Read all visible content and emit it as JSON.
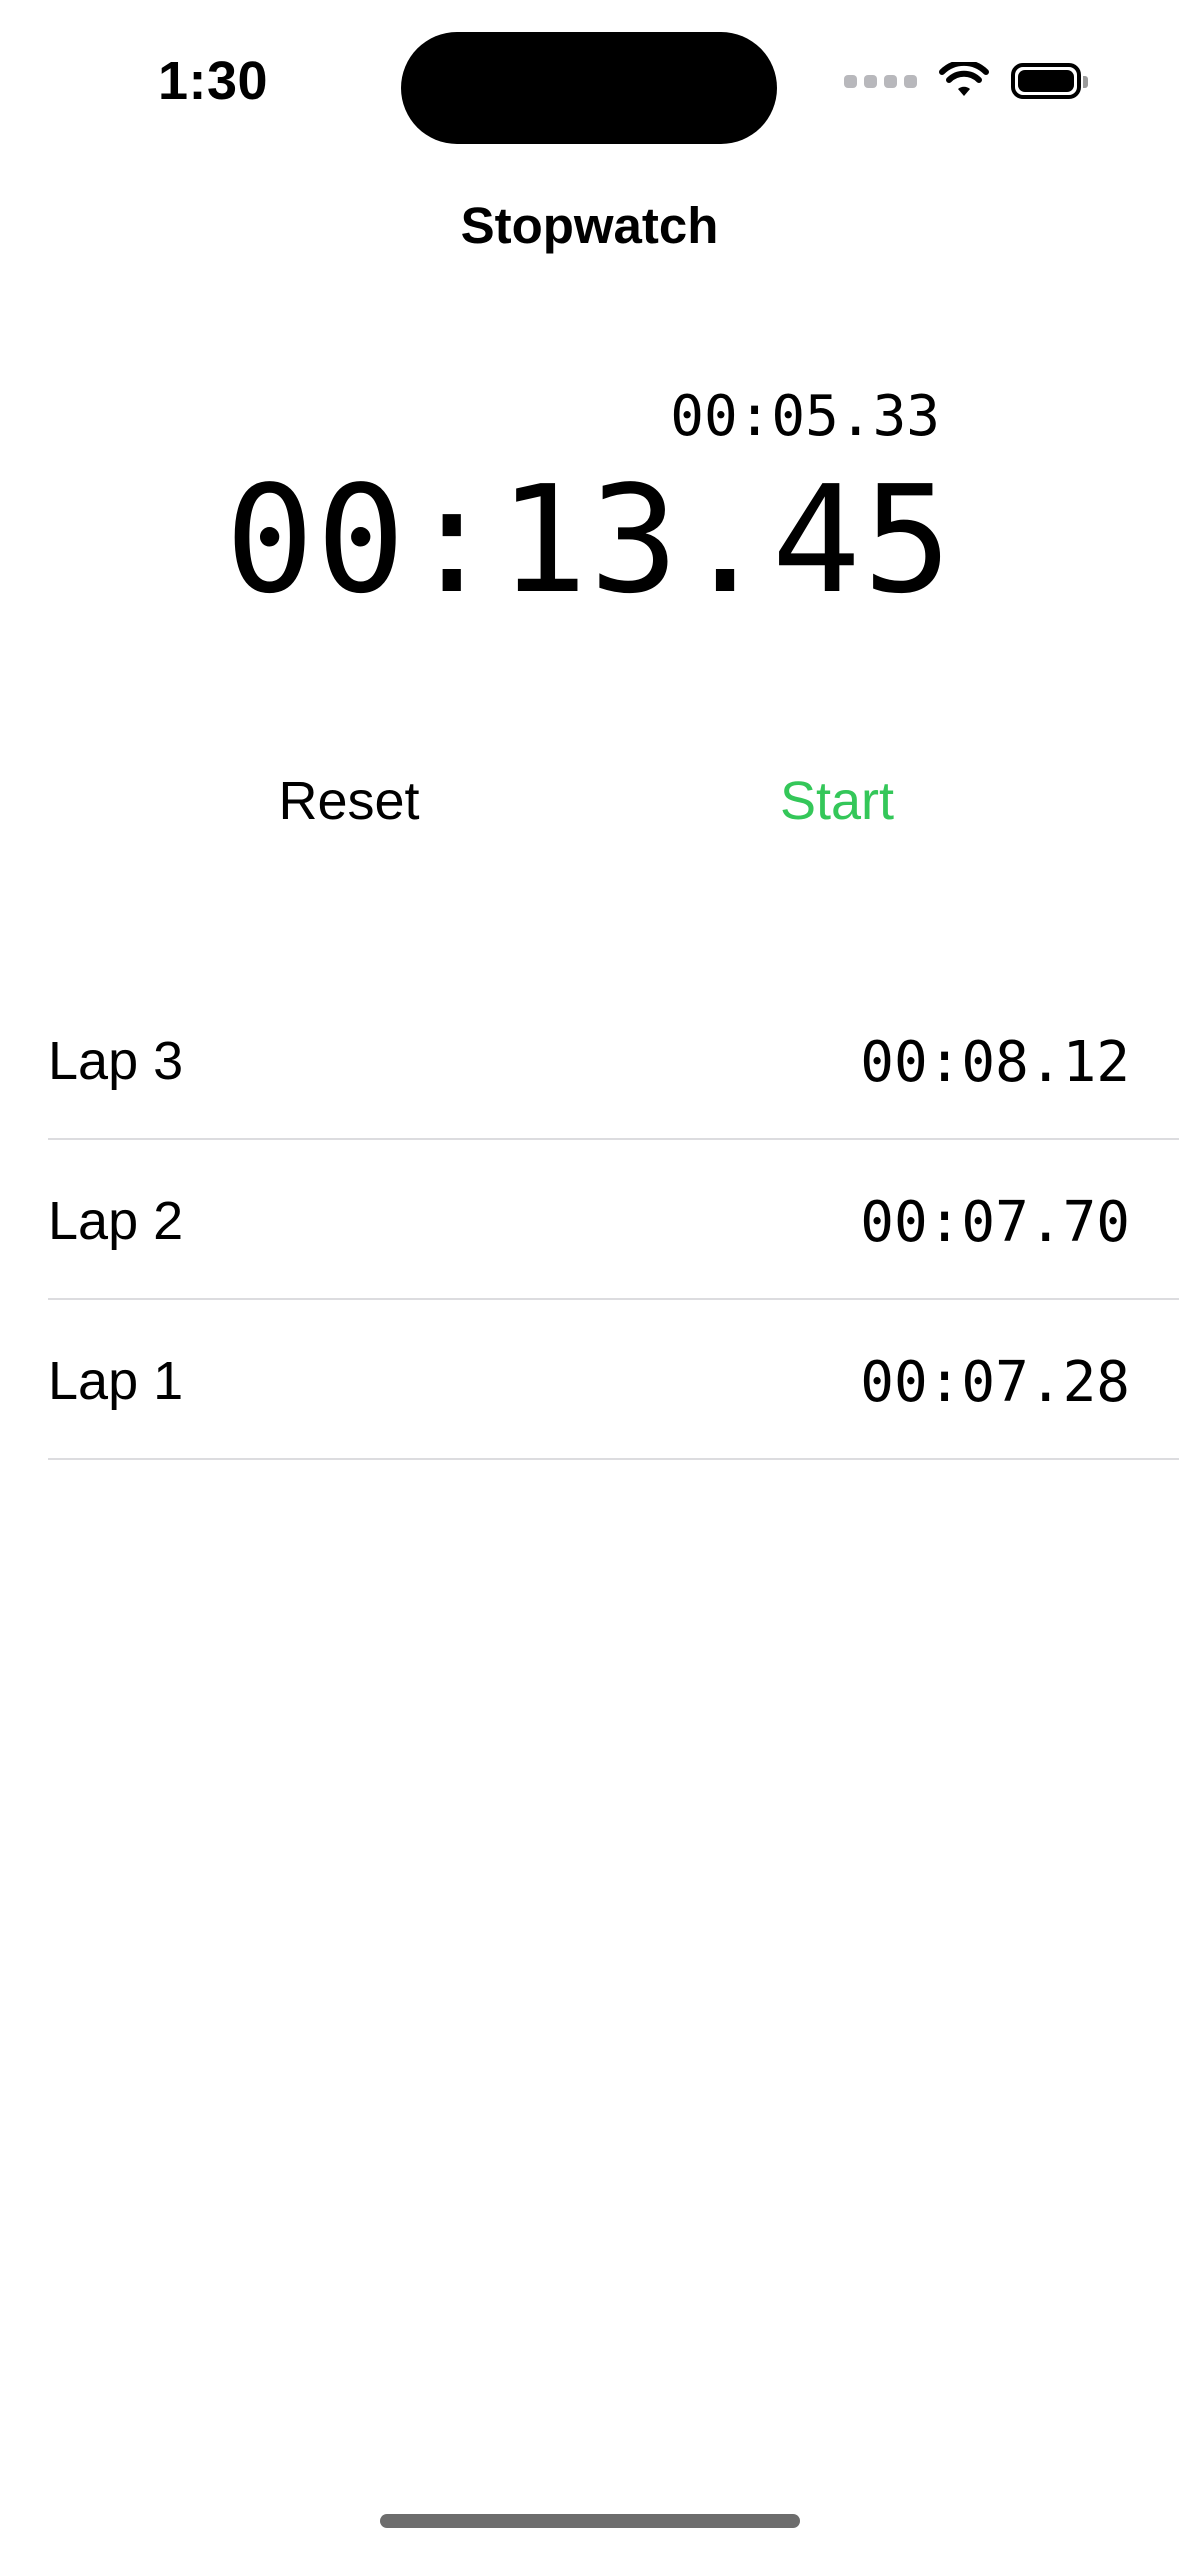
{
  "status_bar": {
    "time": "1:30",
    "icons": [
      "cellular-signal-icon",
      "wifi-icon",
      "battery-icon"
    ]
  },
  "nav": {
    "title": "Stopwatch"
  },
  "timer": {
    "lap_time": "00:05.33",
    "total_time": "00:13.45"
  },
  "controls": {
    "reset_label": "Reset",
    "start_label": "Start",
    "start_color": "#34c759"
  },
  "laps": [
    {
      "label": "Lap 3",
      "time": "00:08.12"
    },
    {
      "label": "Lap 2",
      "time": "00:07.70"
    },
    {
      "label": "Lap 1",
      "time": "00:07.28"
    }
  ]
}
